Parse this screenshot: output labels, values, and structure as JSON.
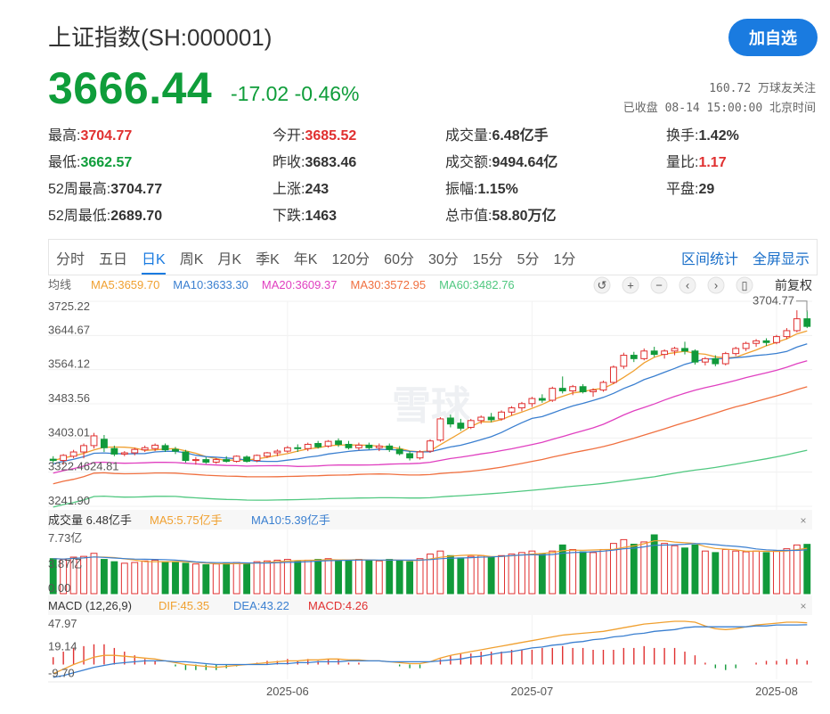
{
  "header": {
    "title": "上证指数(SH:000001)",
    "follow_button": "加自选",
    "price": "3666.44",
    "change": "-17.02 -0.46%",
    "followers": "160.72 万球友关注",
    "status": "已收盘 08-14 15:00:00 北京时间"
  },
  "quote": {
    "rows": [
      [
        {
          "label": "最高:",
          "value": "3704.77",
          "color": "red"
        },
        {
          "label": "今开:",
          "value": "3685.52",
          "color": "red"
        },
        {
          "label": "成交量:",
          "value": "6.48亿手",
          "color": ""
        },
        {
          "label": "换手:",
          "value": "1.42%",
          "color": ""
        }
      ],
      [
        {
          "label": "最低:",
          "value": "3662.57",
          "color": "green"
        },
        {
          "label": "昨收:",
          "value": "3683.46",
          "color": ""
        },
        {
          "label": "成交额:",
          "value": "9494.64亿",
          "color": ""
        },
        {
          "label": "量比:",
          "value": "1.17",
          "color": "red"
        }
      ],
      [
        {
          "label": "52周最高:",
          "value": "3704.77",
          "color": ""
        },
        {
          "label": "上涨:",
          "value": "243",
          "color": ""
        },
        {
          "label": "振幅:",
          "value": "1.15%",
          "color": ""
        },
        {
          "label": "平盘:",
          "value": "29",
          "color": ""
        }
      ],
      [
        {
          "label": "52周最低:",
          "value": "2689.70",
          "color": ""
        },
        {
          "label": "下跌:",
          "value": "1463",
          "color": ""
        },
        {
          "label": "总市值:",
          "value": "58.80万亿",
          "color": ""
        }
      ]
    ]
  },
  "tabs": {
    "periods": [
      "分时",
      "五日",
      "日K",
      "周K",
      "月K",
      "季K",
      "年K",
      "120分",
      "60分",
      "30分",
      "15分",
      "5分",
      "1分"
    ],
    "active": "日K",
    "right": [
      "区间统计",
      "全屏显示"
    ]
  },
  "chart_data": {
    "type": "candlestick",
    "ma_legend": {
      "label": "均线",
      "items": [
        {
          "text": "MA5:3659.70",
          "color": "#f0a030"
        },
        {
          "text": "MA10:3633.30",
          "color": "#3a7fd0"
        },
        {
          "text": "MA20:3609.37",
          "color": "#e040c0"
        },
        {
          "text": "MA30:3572.95",
          "color": "#f07040"
        },
        {
          "text": "MA60:3482.76",
          "color": "#50c880"
        }
      ],
      "adjust": "前复权"
    },
    "price_ticks": [
      "3725.22",
      "3644.67",
      "3564.12",
      "3483.56",
      "3403.01",
      "3322.46",
      "3241.90"
    ],
    "price_overlap_text": "3322.4624.81",
    "ylim": [
      3241.9,
      3725.22
    ],
    "high_label": "3704.77",
    "x_labels": [
      "2025-06",
      "2025-07",
      "2025-08"
    ],
    "watermark": "雪球",
    "candles": [
      [
        3353,
        3360,
        3345,
        3350
      ],
      [
        3350,
        3365,
        3340,
        3362
      ],
      [
        3360,
        3375,
        3355,
        3370
      ],
      [
        3370,
        3390,
        3355,
        3385
      ],
      [
        3385,
        3415,
        3378,
        3408
      ],
      [
        3400,
        3410,
        3370,
        3380
      ],
      [
        3378,
        3385,
        3360,
        3365
      ],
      [
        3365,
        3372,
        3360,
        3368
      ],
      [
        3368,
        3380,
        3362,
        3376
      ],
      [
        3375,
        3385,
        3370,
        3380
      ],
      [
        3378,
        3390,
        3372,
        3386
      ],
      [
        3385,
        3390,
        3370,
        3375
      ],
      [
        3376,
        3382,
        3365,
        3372
      ],
      [
        3370,
        3375,
        3345,
        3350
      ],
      [
        3350,
        3358,
        3340,
        3352
      ],
      [
        3352,
        3358,
        3342,
        3346
      ],
      [
        3346,
        3356,
        3342,
        3352
      ],
      [
        3352,
        3360,
        3345,
        3348
      ],
      [
        3348,
        3362,
        3345,
        3360
      ],
      [
        3358,
        3362,
        3345,
        3348
      ],
      [
        3350,
        3364,
        3346,
        3362
      ],
      [
        3360,
        3370,
        3356,
        3368
      ],
      [
        3368,
        3376,
        3360,
        3372
      ],
      [
        3372,
        3384,
        3368,
        3380
      ],
      [
        3380,
        3388,
        3370,
        3378
      ],
      [
        3378,
        3392,
        3372,
        3388
      ],
      [
        3390,
        3396,
        3378,
        3382
      ],
      [
        3384,
        3398,
        3380,
        3395
      ],
      [
        3396,
        3402,
        3382,
        3388
      ],
      [
        3388,
        3396,
        3376,
        3380
      ],
      [
        3380,
        3392,
        3374,
        3386
      ],
      [
        3386,
        3392,
        3376,
        3380
      ],
      [
        3380,
        3390,
        3372,
        3384
      ],
      [
        3384,
        3390,
        3370,
        3376
      ],
      [
        3376,
        3384,
        3362,
        3366
      ],
      [
        3366,
        3372,
        3350,
        3356
      ],
      [
        3356,
        3374,
        3352,
        3370
      ],
      [
        3372,
        3400,
        3368,
        3396
      ],
      [
        3398,
        3452,
        3394,
        3448
      ],
      [
        3450,
        3458,
        3428,
        3436
      ],
      [
        3438,
        3448,
        3420,
        3426
      ],
      [
        3428,
        3448,
        3424,
        3444
      ],
      [
        3444,
        3456,
        3436,
        3452
      ],
      [
        3452,
        3462,
        3440,
        3446
      ],
      [
        3448,
        3468,
        3444,
        3464
      ],
      [
        3464,
        3478,
        3456,
        3474
      ],
      [
        3474,
        3488,
        3466,
        3484
      ],
      [
        3484,
        3500,
        3476,
        3496
      ],
      [
        3496,
        3506,
        3486,
        3492
      ],
      [
        3492,
        3524,
        3488,
        3520
      ],
      [
        3520,
        3548,
        3508,
        3514
      ],
      [
        3514,
        3528,
        3504,
        3524
      ],
      [
        3524,
        3530,
        3508,
        3512
      ],
      [
        3512,
        3520,
        3500,
        3516
      ],
      [
        3516,
        3538,
        3512,
        3534
      ],
      [
        3534,
        3574,
        3530,
        3570
      ],
      [
        3572,
        3604,
        3566,
        3598
      ],
      [
        3598,
        3606,
        3582,
        3590
      ],
      [
        3590,
        3614,
        3586,
        3608
      ],
      [
        3608,
        3618,
        3594,
        3600
      ],
      [
        3600,
        3612,
        3590,
        3608
      ],
      [
        3608,
        3618,
        3598,
        3614
      ],
      [
        3614,
        3630,
        3600,
        3608
      ],
      [
        3608,
        3612,
        3576,
        3582
      ],
      [
        3582,
        3594,
        3574,
        3590
      ],
      [
        3590,
        3598,
        3572,
        3578
      ],
      [
        3578,
        3606,
        3574,
        3602
      ],
      [
        3602,
        3618,
        3596,
        3614
      ],
      [
        3614,
        3630,
        3608,
        3626
      ],
      [
        3626,
        3636,
        3618,
        3632
      ],
      [
        3632,
        3638,
        3620,
        3628
      ],
      [
        3628,
        3646,
        3624,
        3642
      ],
      [
        3642,
        3662,
        3636,
        3656
      ],
      [
        3656,
        3704,
        3652,
        3684
      ],
      [
        3684,
        3704,
        3662,
        3666
      ]
    ],
    "volume": {
      "legend": [
        {
          "text": "成交量 6.48亿手",
          "color": "#333333"
        },
        {
          "text": "MA5:5.75亿手",
          "color": "#f0a030"
        },
        {
          "text": "MA10:5.39亿手",
          "color": "#3a7fd0"
        }
      ],
      "ticks": [
        "7.73亿",
        "3.87亿",
        "0.00"
      ],
      "ylim": [
        0,
        7.73
      ],
      "values": [
        4.6,
        4.5,
        4.8,
        4.9,
        5.3,
        4.5,
        4.2,
        4.0,
        4.1,
        4.3,
        4.4,
        4.2,
        4.1,
        4.0,
        3.9,
        3.8,
        3.9,
        4.0,
        4.1,
        4.0,
        4.2,
        4.3,
        4.4,
        4.5,
        4.3,
        4.4,
        4.5,
        4.6,
        4.4,
        4.3,
        4.5,
        4.4,
        4.3,
        4.5,
        4.3,
        4.2,
        4.6,
        5.2,
        5.6,
        5.0,
        4.7,
        4.9,
        5.0,
        4.8,
        5.0,
        5.2,
        5.4,
        5.6,
        5.2,
        5.6,
        6.4,
        5.8,
        5.5,
        5.4,
        5.8,
        6.6,
        7.1,
        6.5,
        6.8,
        7.73,
        6.6,
        6.3,
        6.0,
        6.4,
        5.6,
        5.4,
        5.8,
        5.6,
        5.5,
        5.6,
        5.4,
        5.6,
        5.9,
        6.4,
        6.48
      ]
    },
    "macd": {
      "legend": [
        {
          "text": "MACD (12,26,9)",
          "color": "#333333"
        },
        {
          "text": "DIF:45.35",
          "color": "#f0a030"
        },
        {
          "text": "DEA:43.22",
          "color": "#3a7fd0"
        },
        {
          "text": "MACD:4.26",
          "color": "#e03030"
        }
      ],
      "ticks": [
        "47.97",
        "19.14",
        "-9.70"
      ],
      "ylim": [
        -16,
        47.97
      ],
      "dif": [
        -10,
        -5,
        0,
        4,
        8,
        10,
        10,
        9,
        8,
        7,
        6,
        4,
        2,
        0,
        -1,
        -2,
        -3,
        -2,
        -1,
        0,
        1,
        2,
        3,
        4,
        4,
        5,
        5,
        6,
        6,
        5,
        5,
        4,
        4,
        3,
        2,
        1,
        1,
        3,
        7,
        10,
        12,
        14,
        16,
        18,
        20,
        22,
        24,
        26,
        28,
        30,
        32,
        33,
        34,
        35,
        36,
        38,
        40,
        42,
        44,
        45,
        46,
        47,
        47,
        46,
        42,
        39,
        38,
        39,
        41,
        43,
        44,
        45,
        46,
        46,
        45.35
      ],
      "dea": [
        -14,
        -12,
        -9,
        -6,
        -3,
        -1,
        1,
        2,
        3,
        4,
        4,
        4,
        3,
        3,
        2,
        1,
        0,
        0,
        0,
        0,
        0,
        0,
        1,
        1,
        2,
        2,
        3,
        3,
        3,
        4,
        4,
        4,
        4,
        3,
        3,
        3,
        3,
        3,
        4,
        5,
        6,
        8,
        9,
        11,
        13,
        14,
        16,
        18,
        19,
        21,
        22,
        24,
        25,
        27,
        28,
        30,
        31,
        33,
        34,
        36,
        37,
        38,
        40,
        41,
        41,
        41,
        41,
        41,
        41,
        42,
        42,
        43,
        43,
        43,
        43.22
      ]
    }
  }
}
